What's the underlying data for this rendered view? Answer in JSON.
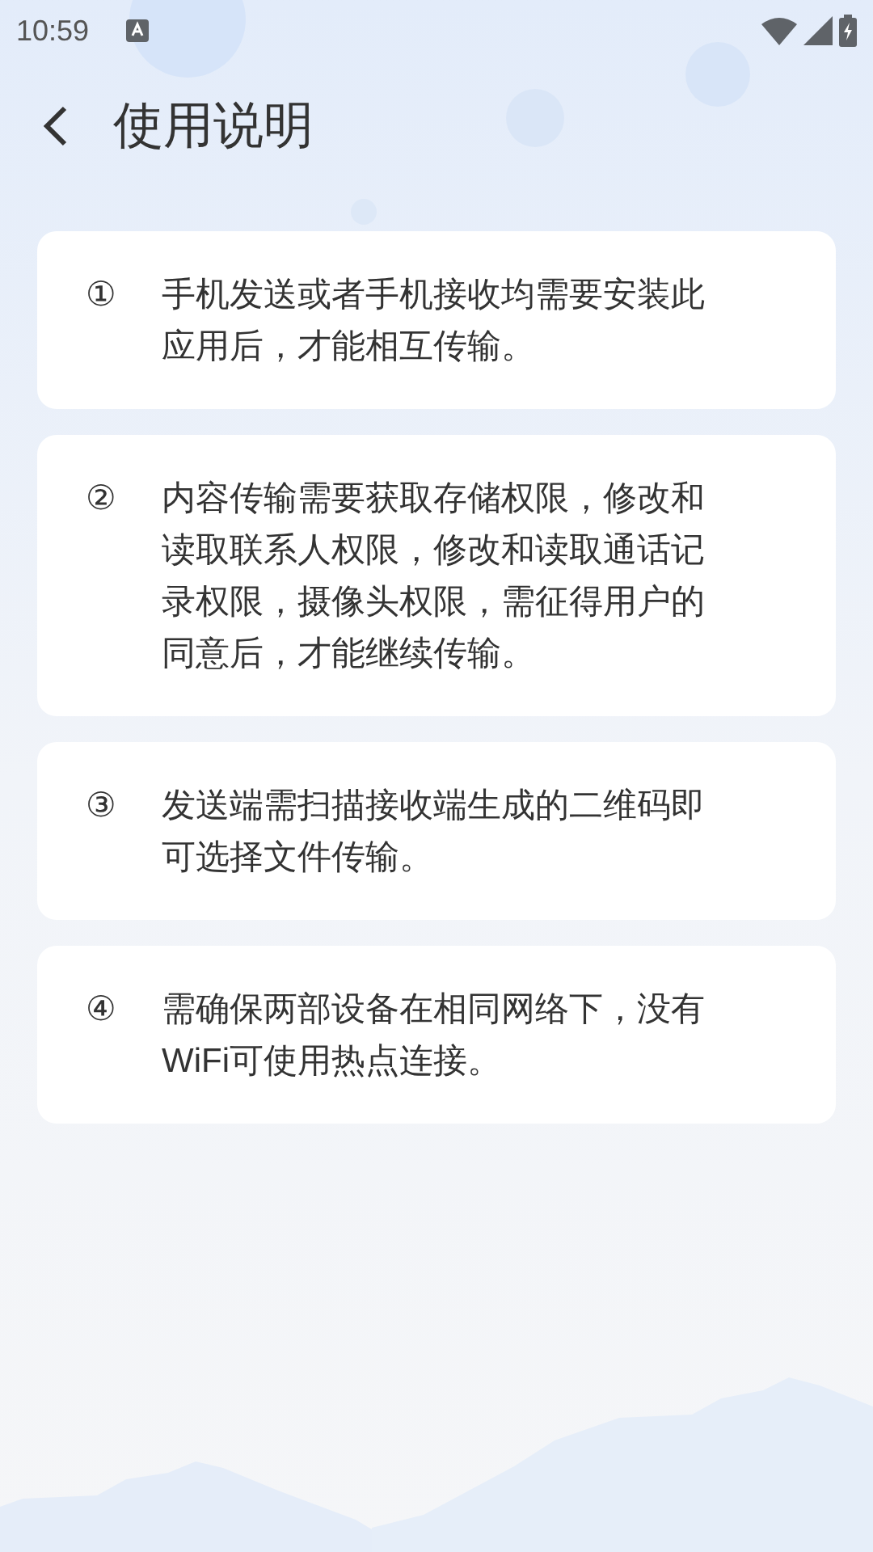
{
  "status_bar": {
    "time": "10:59"
  },
  "header": {
    "title": "使用说明"
  },
  "items": [
    {
      "number": "①",
      "text": "手机发送或者手机接收均需要安装此应用后，才能相互传输。"
    },
    {
      "number": "②",
      "text": "内容传输需要获取存储权限，修改和读取联系人权限，修改和读取通话记录权限，摄像头权限，需征得用户的同意后，才能继续传输。"
    },
    {
      "number": "③",
      "text": "发送端需扫描接收端生成的二维码即可选择文件传输。"
    },
    {
      "number": "④",
      "text": "需确保两部设备在相同网络下，没有WiFi可使用热点连接。"
    }
  ]
}
